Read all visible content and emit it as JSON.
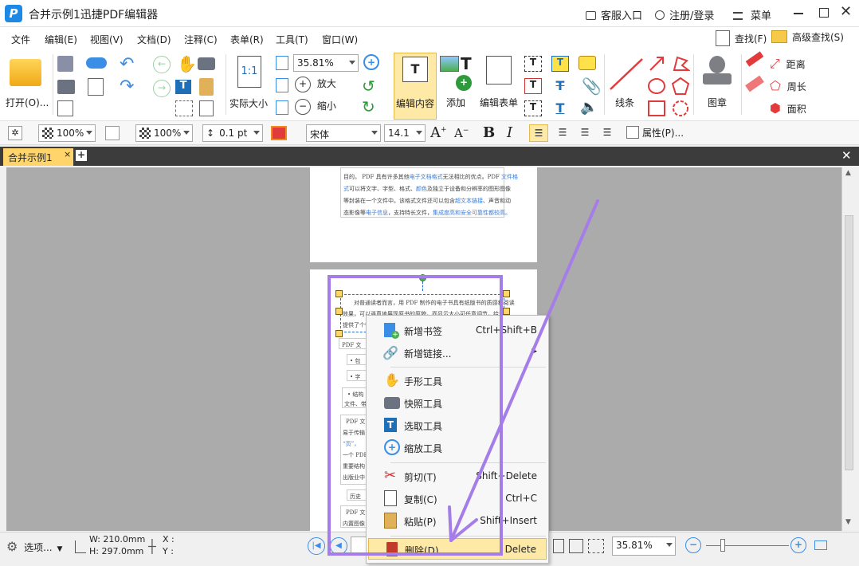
{
  "window": {
    "title": "合并示例1迅捷PDF编辑器",
    "service": "客服入口",
    "login": "注册/登录",
    "menu": "菜单"
  },
  "menubar": {
    "items": [
      "文件",
      "编辑(E)",
      "视图(V)",
      "文档(D)",
      "注释(C)",
      "表单(R)",
      "工具(T)",
      "窗口(W)"
    ],
    "find": "查找(F)",
    "advanced_find": "高级查找(S)"
  },
  "ribbon": {
    "open": "打开(O)...",
    "zoom_value": "35.81%",
    "actual_size": "实际大小",
    "zoom_in": "放大",
    "zoom_out": "缩小",
    "edit_content": "编辑内容",
    "add": "添加",
    "edit_form": "编辑表单",
    "line": "线条",
    "stamp": "图章",
    "distance": "距离",
    "perimeter": "周长",
    "area": "面积"
  },
  "format": {
    "opacity1": "100%",
    "opacity2": "100%",
    "line_width": "0.1 pt",
    "font": "宋体",
    "font_size": "14.1",
    "properties": "属性(P)..."
  },
  "tab": {
    "name": "合并示例1"
  },
  "document": {
    "page1_lines": [
      {
        "a": "目的。 PDF 具有许多其他",
        "b": "电子文档格式",
        "c": "无法相比的优点。PDF ",
        "d": "文件格"
      },
      {
        "a": "式",
        "b": "可以将文字、字型、格式、",
        "c": "颜色",
        "d": "及独立于设备和分辨率的图形图像"
      },
      {
        "a": "等封装在一个文件中。该格式文件还可以包含",
        "b": "超文本链接",
        "c": "、声音和动",
        "d": ""
      },
      {
        "a": "态影像等",
        "b": "电子信息",
        "c": "，支持特长文件，",
        "d": "集成度高和安全可靠性都较高。"
      }
    ],
    "page2_line1": "对普通读者而言，用 PDF 制作的电子书具有纸版书的质感和阅读",
    "page2_line2": "效果，可以逼真地展现原书的原貌，而显示大小可任意调节，给读者",
    "page2_line3": "提供了个性化的阅读方式。",
    "frag": [
      "PDF 文",
      "• 包",
      "• 字",
      "• 结构",
      "文件、带",
      "PDF 文",
      "易于传输",
      "“页”，",
      "一个 PDF",
      "重要结构",
      "出版业中",
      "历史",
      "PDF 文",
      "内置图像"
    ]
  },
  "context_menu": {
    "items": [
      {
        "label": "新增书签",
        "shortcut": "Ctrl+Shift+B",
        "icon": "bookmark-add-icon"
      },
      {
        "label": "新增链接...",
        "shortcut": "",
        "icon": "link-add-icon"
      },
      {
        "label": "手形工具",
        "shortcut": "",
        "icon": "hand-icon"
      },
      {
        "label": "快照工具",
        "shortcut": "",
        "icon": "camera-icon"
      },
      {
        "label": "选取工具",
        "shortcut": "",
        "icon": "select-text-icon"
      },
      {
        "label": "缩放工具",
        "shortcut": "",
        "icon": "zoom-icon"
      },
      {
        "label": "剪切(T)",
        "shortcut": "Shift+Delete",
        "icon": "scissors-icon"
      },
      {
        "label": "复制(C)",
        "shortcut": "Ctrl+C",
        "icon": "copy-icon"
      },
      {
        "label": "粘贴(P)",
        "shortcut": "Shift+Insert",
        "icon": "paste-icon"
      },
      {
        "label": "删除(D)",
        "shortcut": "Delete",
        "icon": "trash-icon"
      }
    ]
  },
  "status": {
    "options": "选项...",
    "width": "W: 210.0mm",
    "height": "H: 297.0mm",
    "x": "X :",
    "y": "Y :",
    "zoom": "35.81%"
  },
  "colors": {
    "accent": "#1e88e5",
    "annotation": "#a57de8",
    "highlight": "#ffe9a6"
  }
}
